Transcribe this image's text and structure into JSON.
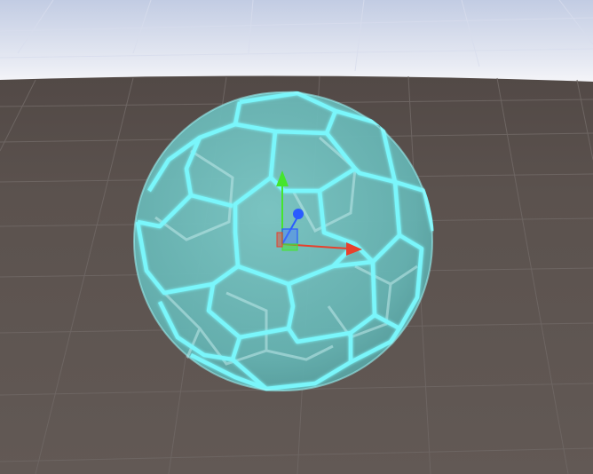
{
  "scene": {
    "view": "scene-view",
    "sky_color_top": "#c9d2e6",
    "sky_color_horizon": "#f3f4f8",
    "ground_color": "#5e5551",
    "grid_color": "#6f6763"
  },
  "object": {
    "shape": "truncated-icosahedron",
    "fill_color": "#6fbfbe",
    "edge_glow_color": "#7af6fb",
    "selected": true
  },
  "gizmo": {
    "mode": "move",
    "axes": [
      {
        "axis": "y",
        "color": "#45e52d"
      },
      {
        "axis": "x",
        "color": "#e8402c"
      },
      {
        "axis": "z",
        "color": "#2a5bff"
      }
    ]
  }
}
